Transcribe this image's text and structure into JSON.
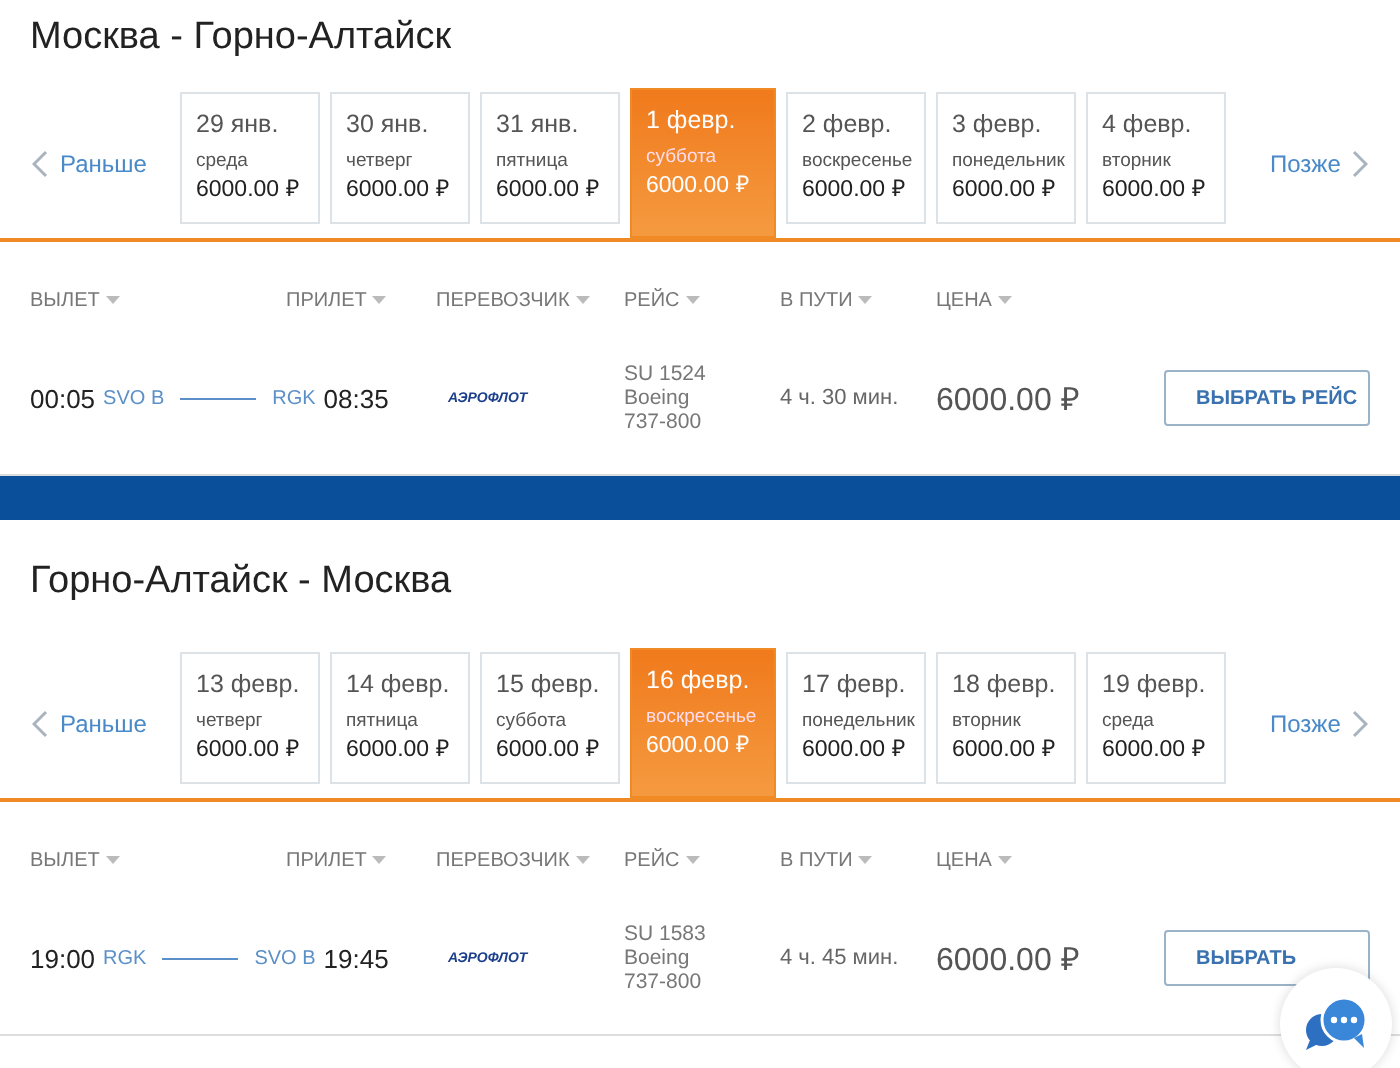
{
  "sections": [
    {
      "title": "Москва - Горно-Алтайск",
      "prev": "Раньше",
      "next": "Позже",
      "dates": [
        {
          "date": "29 янв.",
          "weekday": "среда",
          "price": "6000.00 ₽",
          "selected": false
        },
        {
          "date": "30 янв.",
          "weekday": "четверг",
          "price": "6000.00 ₽",
          "selected": false
        },
        {
          "date": "31 янв.",
          "weekday": "пятница",
          "price": "6000.00 ₽",
          "selected": false
        },
        {
          "date": "1 февр.",
          "weekday": "суббота",
          "price": "6000.00 ₽",
          "selected": true
        },
        {
          "date": "2 февр.",
          "weekday": "воскресенье",
          "price": "6000.00 ₽",
          "selected": false
        },
        {
          "date": "3 февр.",
          "weekday": "понедельник",
          "price": "6000.00 ₽",
          "selected": false
        },
        {
          "date": "4 февр.",
          "weekday": "вторник",
          "price": "6000.00 ₽",
          "selected": false
        }
      ],
      "columns": [
        "ВЫЛЕТ",
        "ПРИЛЕТ",
        "ПЕРЕВОЗЧИК",
        "РЕЙС",
        "В ПУТИ",
        "ЦЕНА"
      ],
      "flight": {
        "dep_time": "00:05",
        "dep_airport": "SVO B",
        "arr_airport": "RGK",
        "arr_time": "08:35",
        "airline": "АЭРОФЛОТ",
        "flight_no": "SU 1524",
        "aircraft": "Boeing",
        "model": "737-800",
        "duration": "4 ч. 30 мин.",
        "price": "6000.00 ₽",
        "button": "ВЫБРАТЬ РЕЙС"
      }
    },
    {
      "title": "Горно-Алтайск - Москва",
      "prev": "Раньше",
      "next": "Позже",
      "dates": [
        {
          "date": "13 февр.",
          "weekday": "четверг",
          "price": "6000.00 ₽",
          "selected": false
        },
        {
          "date": "14 февр.",
          "weekday": "пятница",
          "price": "6000.00 ₽",
          "selected": false
        },
        {
          "date": "15 февр.",
          "weekday": "суббота",
          "price": "6000.00 ₽",
          "selected": false
        },
        {
          "date": "16 февр.",
          "weekday": "воскресенье",
          "price": "6000.00 ₽",
          "selected": true
        },
        {
          "date": "17 февр.",
          "weekday": "понедельник",
          "price": "6000.00 ₽",
          "selected": false
        },
        {
          "date": "18 февр.",
          "weekday": "вторник",
          "price": "6000.00 ₽",
          "selected": false
        },
        {
          "date": "19 февр.",
          "weekday": "среда",
          "price": "6000.00 ₽",
          "selected": false
        }
      ],
      "columns": [
        "ВЫЛЕТ",
        "ПРИЛЕТ",
        "ПЕРЕВОЗЧИК",
        "РЕЙС",
        "В ПУТИ",
        "ЦЕНА"
      ],
      "flight": {
        "dep_time": "19:00",
        "dep_airport": "RGK",
        "arr_airport": "SVO B",
        "arr_time": "19:45",
        "airline": "АЭРОФЛОТ",
        "flight_no": "SU 1583",
        "aircraft": "Boeing",
        "model": "737-800",
        "duration": "4 ч. 45 мин.",
        "price": "6000.00 ₽",
        "button": "ВЫБРАТЬ"
      }
    }
  ]
}
